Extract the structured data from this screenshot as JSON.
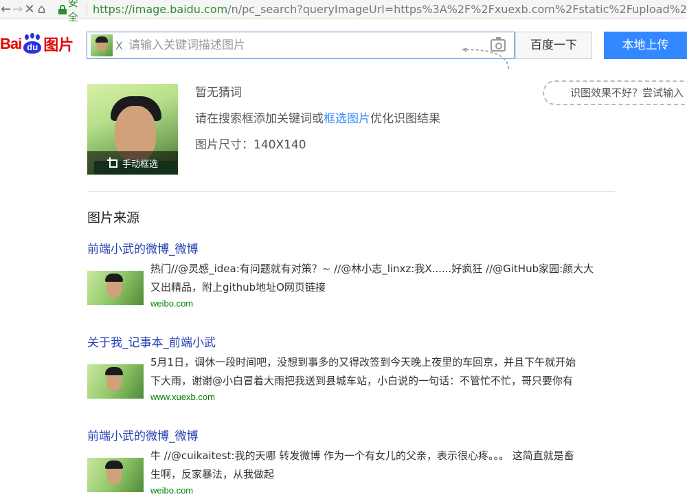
{
  "browser": {
    "back_icon": "←",
    "forward_icon": "→",
    "close_icon": "✕",
    "home_icon": "⌂",
    "secure_label": "安全",
    "url_host": "https://image.baidu.com",
    "url_path": "/n/pc_search?queryImageUrl=https%3A%2F%2Fxuexb.com%2Fstatic%2Fupload%2"
  },
  "header": {
    "logo_bai": "Bai",
    "logo_du": "du",
    "logo_image": "图片",
    "clear_label": "X",
    "search_placeholder": "请输入关键词描述图片",
    "search_button": "百度一下",
    "upload_button": "本地上传",
    "hint_bubble": "识图效果不好？尝试输入"
  },
  "info": {
    "crop_label": "手动框选",
    "no_guess": "暂无猜词",
    "hint_prefix": "请在搜索框添加关键词或",
    "hint_link": "框选图片",
    "hint_suffix": "优化识图结果",
    "size_label": "图片尺寸：",
    "size_value": "140X140"
  },
  "sources": {
    "title": "图片来源",
    "items": [
      {
        "title": "前端小武的微博_微博",
        "desc_line1": "热门//@灵感_idea:有问题就有对策？~ //@林小志_linxz:我X......好疯狂 //@GitHub家园:颜大大",
        "desc_line2": "又出精品，附上github地址O网页链接",
        "url": "weibo.com"
      },
      {
        "title": "关于我_记事本_前端小武",
        "desc_line1": "5月1日，调休一段时间吧，没想到事多的又得改签到今天晚上夜里的车回京，并且下午就开始",
        "desc_line2": "下大雨，谢谢@小白冒着大雨把我送到县城车站，小白说的一句话：不管忙不忙，哥只要你有",
        "url": "www.xuexb.com"
      },
      {
        "title": "前端小武的微博_微博",
        "desc_line1": "牛 //@cuikaitest:我的天哪 转发微博 作为一个有女儿的父亲，表示很心疼。。。 这简直就是畜",
        "desc_line2": "生啊，反家暴法，从我做起",
        "url": "weibo.com"
      }
    ]
  },
  "colors": {
    "brand_red": "#e10602",
    "brand_blue": "#2932e1",
    "upload_blue": "#3388ff",
    "link_blue": "#2440b3",
    "url_green": "#008000",
    "secure_green": "#2d8d2d"
  },
  "icons": {
    "camera": "camera-icon",
    "crop": "crop-icon",
    "lock": "lock-icon"
  }
}
